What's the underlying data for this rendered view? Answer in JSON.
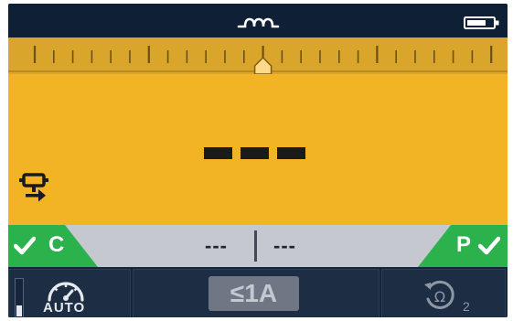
{
  "topbar": {
    "mode_icon": "coil-icon",
    "battery_icon": "battery-icon"
  },
  "scale": {
    "pointer_icon": "pointer-icon"
  },
  "display": {
    "reading": "---",
    "mode_icon": "plug-arrow-icon"
  },
  "status": {
    "left": {
      "label": "C",
      "icon": "check-icon"
    },
    "right": {
      "label": "P",
      "icon": "check-icon"
    },
    "readout_left": "---",
    "readout_right": "---"
  },
  "bottom": {
    "meter_level_fraction": 0.3,
    "auto_label": "AUTO",
    "auto_icon": "gauge-icon",
    "range_label": "≤1A",
    "omega_icon": "rotate-ohm-icon",
    "omega_subscript": "2"
  },
  "colors": {
    "accent": "#f2b324",
    "ok": "#2bb24c",
    "panel": "#16253a",
    "status": "#c5c8ce"
  }
}
